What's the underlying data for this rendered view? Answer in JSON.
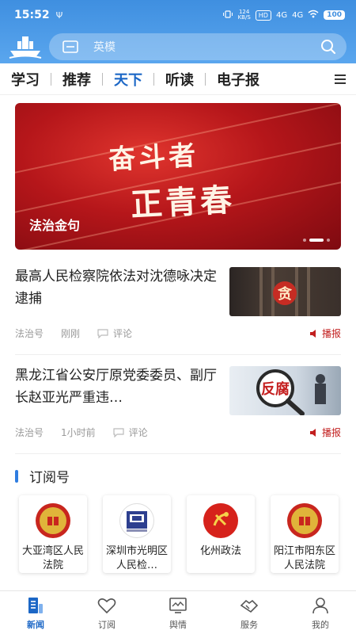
{
  "status_bar": {
    "time": "15:52",
    "left_icon": "Ψ",
    "net_speed_top": "124",
    "net_speed_bottom": "KB/S",
    "hd_badge": "HD",
    "signal_1": "4G",
    "signal_2": "4G",
    "battery": "100"
  },
  "search": {
    "placeholder": "英模"
  },
  "tabs": [
    {
      "label": "学习"
    },
    {
      "label": "推荐"
    },
    {
      "label": "天下",
      "active": true
    },
    {
      "label": "听读"
    },
    {
      "label": "电子报"
    }
  ],
  "banner": {
    "art_line_1": "奋斗者",
    "art_line_2": "正青春",
    "caption": "法治金句"
  },
  "news": [
    {
      "title": "最高人民检察院依法对沈德咏决定逮捕",
      "source": "法治号",
      "time": "刚刚",
      "comment_label": "评论",
      "broadcast_label": "播报",
      "thumb_text": "贪"
    },
    {
      "title": "黑龙江省公安厅原党委委员、副厅长赵亚光严重违…",
      "source": "法治号",
      "time": "1小时前",
      "comment_label": "评论",
      "broadcast_label": "播报",
      "thumb_text": "反腐"
    }
  ],
  "subscriptions": {
    "title": "订阅号",
    "items": [
      {
        "name": "大亚湾区人民法院",
        "logo_icon": "court-emblem-icon"
      },
      {
        "name": "深圳市光明区人民检…",
        "logo_icon": "procuratorate-emblem-icon"
      },
      {
        "name": "化州政法",
        "logo_icon": "party-emblem-icon"
      },
      {
        "name": "阳江市阳东区人民法院",
        "logo_icon": "court-emblem-icon"
      }
    ]
  },
  "bottom_nav": [
    {
      "label": "新闻",
      "icon": "news-icon",
      "active": true
    },
    {
      "label": "订阅",
      "icon": "heart-icon"
    },
    {
      "label": "舆情",
      "icon": "monitor-icon"
    },
    {
      "label": "服务",
      "icon": "handshake-icon"
    },
    {
      "label": "我的",
      "icon": "user-icon"
    }
  ],
  "colors": {
    "header_blue": "#3f8fe0",
    "accent_blue": "#1c67c6",
    "broadcast_red": "#c21f1f"
  }
}
